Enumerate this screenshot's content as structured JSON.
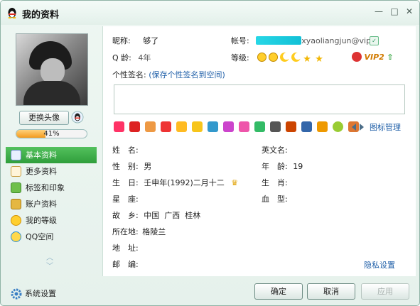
{
  "window": {
    "title": "我的资料",
    "minimize": "—",
    "maximize": "□",
    "close": "✕"
  },
  "left": {
    "change_avatar": "更换头像",
    "progress_percent": 41,
    "progress_label": "41%",
    "nav": [
      {
        "label": "基本资料",
        "icon": "profile-card-icon",
        "active": true
      },
      {
        "label": "更多资料",
        "icon": "more-info-icon",
        "active": false
      },
      {
        "label": "标签和印象",
        "icon": "tags-icon",
        "active": false
      },
      {
        "label": "账户资料",
        "icon": "account-icon",
        "active": false
      },
      {
        "label": "我的等级",
        "icon": "level-icon",
        "active": false
      },
      {
        "label": "QQ空间",
        "icon": "qzone-icon",
        "active": false
      }
    ],
    "nav_up": "︿",
    "nav_down": "﹀",
    "system_settings": "系统设置"
  },
  "profile": {
    "nickname_label": "昵称:",
    "nickname": "够了",
    "account_label": "帐号:",
    "account_visible": "xyaoliangjun@vip.",
    "qage_label": "Q 龄:",
    "qage": "4年",
    "level_label": "等级:",
    "vip_label": "VIP2",
    "signature_label": "个性签名:",
    "signature_link": "(保存个性签名到空间)",
    "icon_management": "图标管理"
  },
  "details": {
    "name_label": "姓　名:",
    "name": "",
    "english_name_label": "英文名:",
    "english_name": "",
    "gender_label": "性　别:",
    "gender": "男",
    "age_label": "年　龄:",
    "age": "19",
    "birthday_label": "生　日:",
    "birthday": "壬申年(1992)二月十二",
    "zodiac_label": "生　肖:",
    "zodiac": "",
    "constellation_label": "星　座:",
    "constellation": "",
    "blood_label": "血　型:",
    "blood": "",
    "hometown_label": "故　乡:",
    "hometown": "中国  广西  桂林",
    "location_label": "所在地:",
    "location": "格陵兰",
    "address_label": "地　址:",
    "address": "",
    "postcode_label": "邮　编:",
    "postcode": "",
    "privacy_settings": "隐私设置"
  },
  "buttons": {
    "ok": "确定",
    "cancel": "取消",
    "apply": "应用"
  },
  "colors": {
    "accent_green": "#2f9e3b",
    "link_blue": "#1f5fa8",
    "progress_orange": "#f39b1e"
  }
}
